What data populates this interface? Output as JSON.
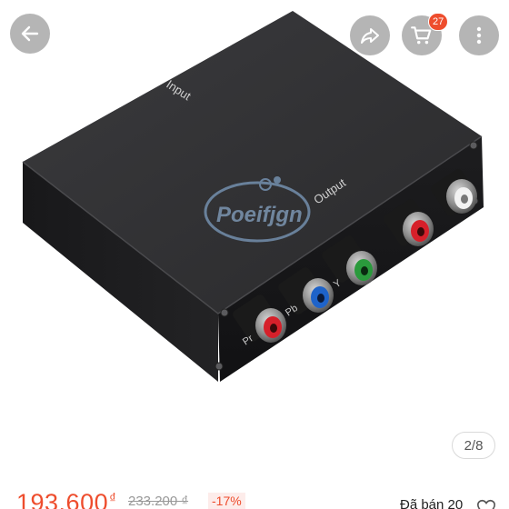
{
  "product": {
    "image_label_input": "Input",
    "image_label_output": "Output",
    "image_label_pr": "Pr",
    "image_label_pb": "Pb",
    "image_label_y": "Y",
    "watermark_text": "Poeifjgn",
    "gallery": {
      "current": "2",
      "total": "8",
      "indicator": "2/8"
    }
  },
  "header": {
    "back_icon": "arrow-left-icon",
    "share_icon": "share-icon",
    "cart_icon": "cart-icon",
    "more_icon": "more-vertical-icon",
    "cart_count": "27"
  },
  "pricing": {
    "price": "193.600",
    "currency": "₫",
    "old_price": "233.200 ₫",
    "discount": "-17%",
    "sold": "Đã bán 20",
    "favorite_icon": "heart-outline-icon"
  },
  "colors": {
    "accent": "#ee4d2d",
    "device": "#2b2b2d",
    "connector_red": "#d6202a",
    "connector_blue": "#1e63c9",
    "connector_green": "#2a9a3c"
  }
}
